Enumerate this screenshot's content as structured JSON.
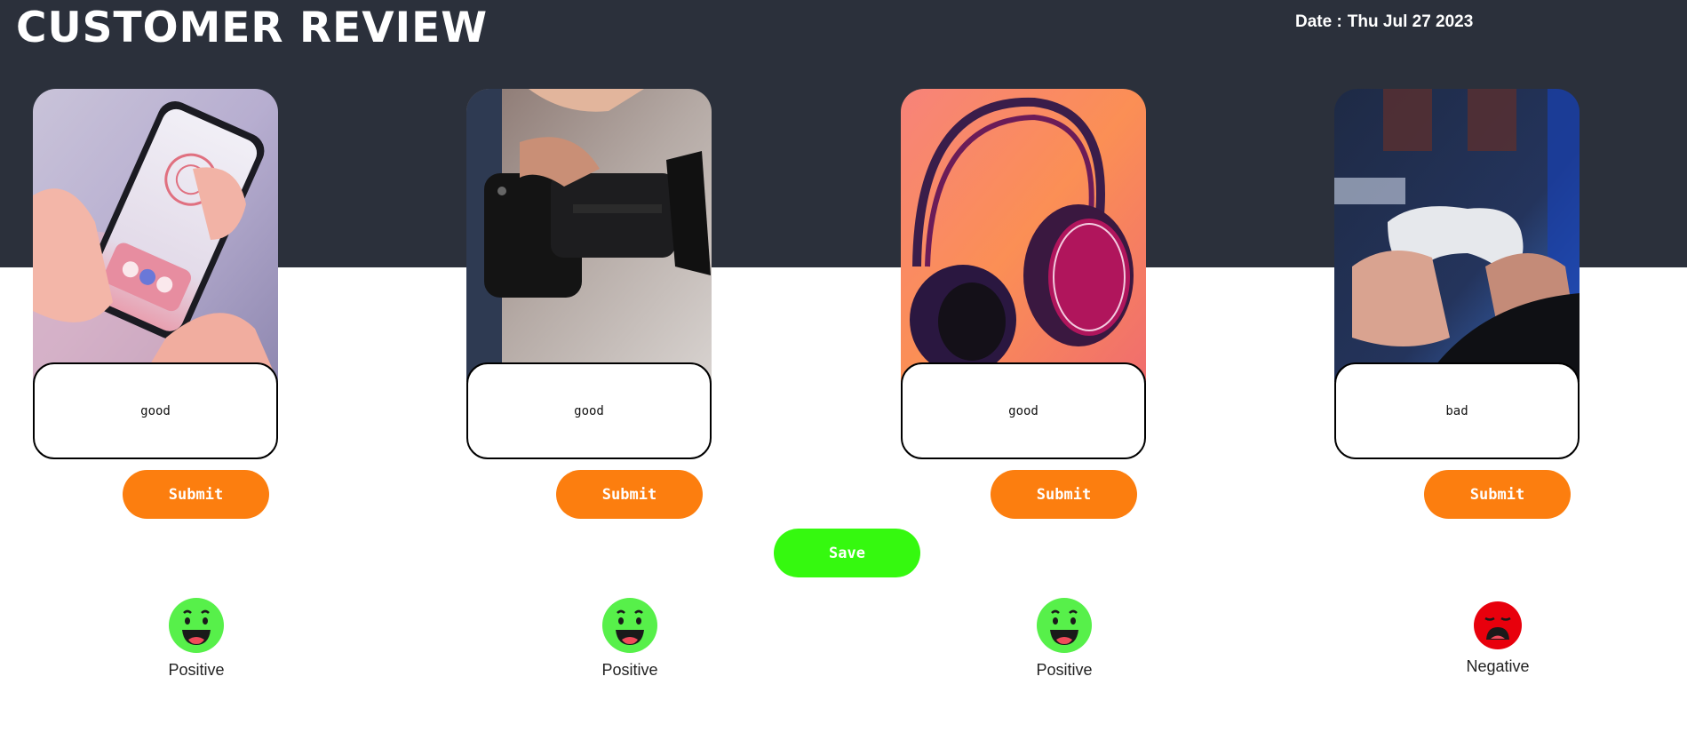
{
  "header": {
    "title": "CUSTOMER REVIEW",
    "date_label": "Date :",
    "date_value": "Thu Jul 27 2023"
  },
  "cards": [
    {
      "image_subject": "smartphone-in-hands",
      "review_text": "good",
      "submit_label": "Submit",
      "sentiment": "Positive",
      "sentiment_icon": "happy-face-icon"
    },
    {
      "image_subject": "camera-in-hands",
      "review_text": "good",
      "submit_label": "Submit",
      "sentiment": "Positive",
      "sentiment_icon": "happy-face-icon"
    },
    {
      "image_subject": "headphones",
      "review_text": "good",
      "submit_label": "Submit",
      "sentiment": "Positive",
      "sentiment_icon": "happy-face-icon"
    },
    {
      "image_subject": "game-controller-in-hands",
      "review_text": "bad",
      "submit_label": "Submit",
      "sentiment": "Negative",
      "sentiment_icon": "sad-face-icon"
    }
  ],
  "save_label": "Save",
  "colors": {
    "header_bg": "#2b303b",
    "submit_bg": "#fc7e0f",
    "save_bg": "#35f90f",
    "positive": "#57f04a",
    "negative": "#e8000c"
  }
}
